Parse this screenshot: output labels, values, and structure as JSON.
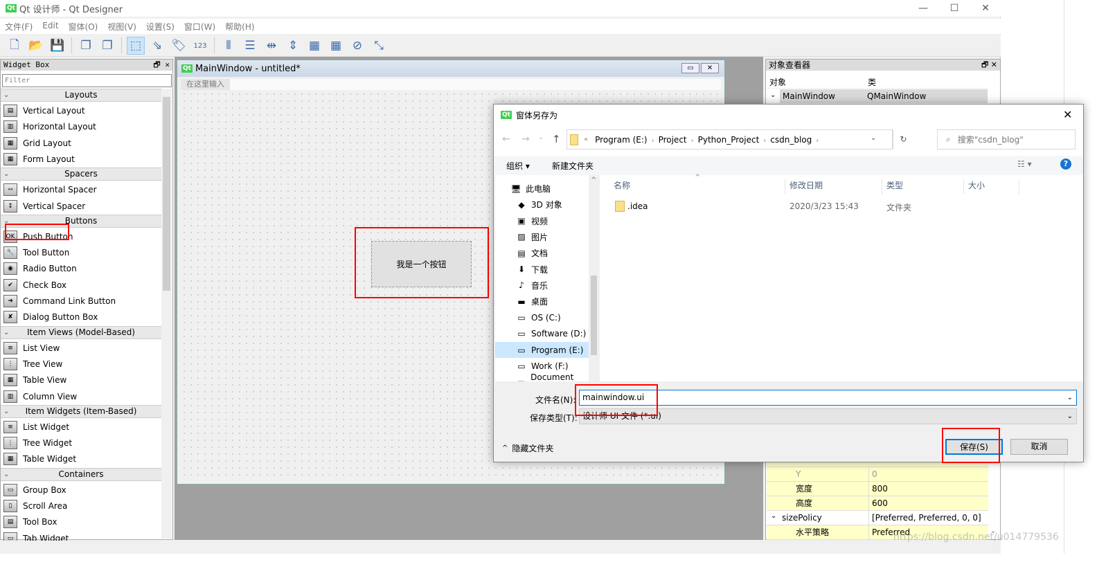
{
  "app": {
    "title": "Qt 设计师 - Qt Designer",
    "logo": "Qt",
    "menu": [
      "文件(F)",
      "Edit",
      "窗体(O)",
      "视图(V)",
      "设置(S)",
      "窗口(W)",
      "帮助(H)"
    ],
    "toolbar_icons": [
      "new-file-icon",
      "open-folder-icon",
      "save-icon",
      "bring-front-icon",
      "send-back-icon",
      "edit-widgets-icon",
      "edit-signals-slots-icon",
      "edit-buddies-icon",
      "edit-tab-order-icon",
      "layout-horizontal-icon",
      "layout-vertical-icon",
      "layout-h-splitter-icon",
      "layout-v-splitter-icon",
      "layout-grid-icon",
      "layout-form-icon",
      "break-layout-icon",
      "adjust-size-icon"
    ]
  },
  "widget_box": {
    "title": "Widget Box",
    "filter_placeholder": "Filter",
    "rows": [
      {
        "type": "cat",
        "label": "Layouts"
      },
      {
        "type": "item",
        "label": "Vertical Layout",
        "icon": "▤"
      },
      {
        "type": "item",
        "label": "Horizontal Layout",
        "icon": "▥"
      },
      {
        "type": "item",
        "label": "Grid Layout",
        "icon": "▦"
      },
      {
        "type": "item",
        "label": "Form Layout",
        "icon": "▦"
      },
      {
        "type": "cat",
        "label": "Spacers"
      },
      {
        "type": "item",
        "label": "Horizontal Spacer",
        "icon": "⇿"
      },
      {
        "type": "item",
        "label": "Vertical Spacer",
        "icon": "↕"
      },
      {
        "type": "cat",
        "label": "Buttons"
      },
      {
        "type": "item",
        "label": "Push Button",
        "icon": "OK"
      },
      {
        "type": "item",
        "label": "Tool Button",
        "icon": "🔧"
      },
      {
        "type": "item",
        "label": "Radio Button",
        "icon": "◉"
      },
      {
        "type": "item",
        "label": "Check Box",
        "icon": "✔"
      },
      {
        "type": "item",
        "label": "Command Link Button",
        "icon": "➜"
      },
      {
        "type": "item",
        "label": "Dialog Button Box",
        "icon": "✘"
      },
      {
        "type": "cat",
        "label": "Item Views (Model-Based)"
      },
      {
        "type": "item",
        "label": "List View",
        "icon": "≡"
      },
      {
        "type": "item",
        "label": "Tree View",
        "icon": "⋮"
      },
      {
        "type": "item",
        "label": "Table View",
        "icon": "▦"
      },
      {
        "type": "item",
        "label": "Column View",
        "icon": "▥"
      },
      {
        "type": "cat",
        "label": "Item Widgets (Item-Based)"
      },
      {
        "type": "item",
        "label": "List Widget",
        "icon": "≡"
      },
      {
        "type": "item",
        "label": "Tree Widget",
        "icon": "⋮"
      },
      {
        "type": "item",
        "label": "Table Widget",
        "icon": "▦"
      },
      {
        "type": "cat",
        "label": "Containers"
      },
      {
        "type": "item",
        "label": "Group Box",
        "icon": "▭"
      },
      {
        "type": "item",
        "label": "Scroll Area",
        "icon": "▯"
      },
      {
        "type": "item",
        "label": "Tool Box",
        "icon": "▤"
      },
      {
        "type": "item",
        "label": "Tab Widget",
        "icon": "▭"
      }
    ]
  },
  "form": {
    "title": "MainWindow - untitled*",
    "menu_placeholder": "在这里输入",
    "push_button_text": "我是一个按钮"
  },
  "object_inspector": {
    "title": "对象查看器",
    "col_object": "对象",
    "col_class": "类",
    "row_object": "MainWindow",
    "row_class": "QMainWindow"
  },
  "properties": [
    {
      "key": "Y",
      "value": "0",
      "dim": true
    },
    {
      "key": "宽度",
      "value": "800"
    },
    {
      "key": "高度",
      "value": "600"
    },
    {
      "key": "sizePolicy",
      "value": "[Preferred, Preferred, 0, 0]",
      "expand": true
    },
    {
      "key": "水平策略",
      "value": "Preferred"
    }
  ],
  "dialog": {
    "title": "窗体另存为",
    "breadcrumb": [
      "Program (E:)",
      "Project",
      "Python_Project",
      "csdn_blog"
    ],
    "search_placeholder": "搜索\"csdn_blog\"",
    "organize": "组织 ▾",
    "new_folder": "新建文件夹",
    "nav": [
      {
        "label": "此电脑",
        "icon": "🖥",
        "level": 0
      },
      {
        "label": "3D 对象",
        "icon": "◆"
      },
      {
        "label": "视频",
        "icon": "▣"
      },
      {
        "label": "图片",
        "icon": "▨"
      },
      {
        "label": "文档",
        "icon": "▤"
      },
      {
        "label": "下载",
        "icon": "⬇"
      },
      {
        "label": "音乐",
        "icon": "♪"
      },
      {
        "label": "桌面",
        "icon": "▬"
      },
      {
        "label": "OS (C:)",
        "icon": "▭"
      },
      {
        "label": "Software (D:)",
        "icon": "▭"
      },
      {
        "label": "Program (E:)",
        "icon": "▭",
        "selected": true
      },
      {
        "label": "Work (F:)",
        "icon": "▭"
      },
      {
        "label": "Document (G:)",
        "icon": "▭"
      }
    ],
    "columns": [
      "名称",
      "修改日期",
      "类型",
      "大小"
    ],
    "files": [
      {
        "name": ".idea",
        "date": "2020/3/23 15:43",
        "type": "文件夹",
        "size": ""
      }
    ],
    "filename_label": "文件名(N):",
    "filename_value": "mainwindow.ui",
    "filetype_label": "保存类型(T):",
    "filetype_value": "设计师 UI 文件 (*.ui)",
    "hide_folders": "隐藏文件夹",
    "save": "保存(S)",
    "cancel": "取消"
  },
  "watermark": "https://blog.csdn.net/u014779536",
  "colors": {
    "highlight_red": "#ff0000",
    "accent_blue": "#0078d7",
    "property_bg": "#ffffc8"
  }
}
